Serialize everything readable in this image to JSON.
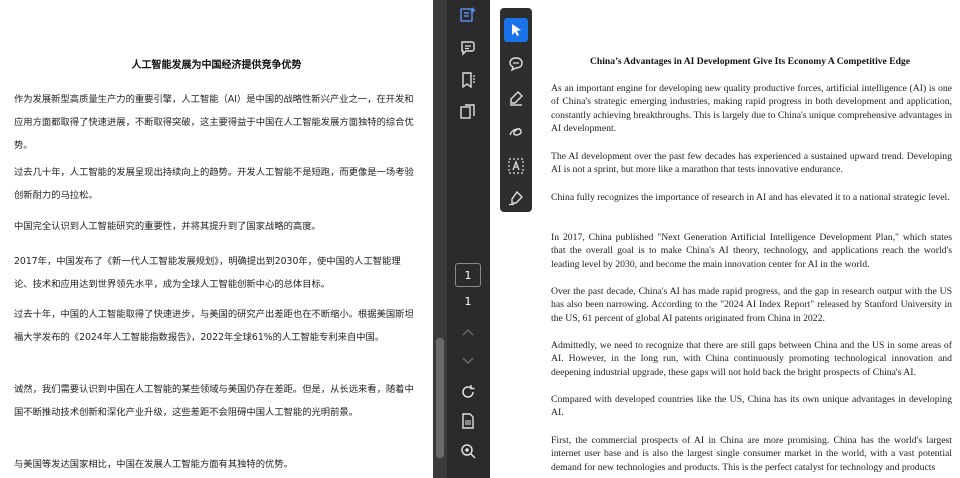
{
  "left_document": {
    "title": "人工智能发展为中国经济提供竞争优势",
    "paragraphs": [
      "作为发展新型高质量生产力的重要引擎，人工智能（AI）是中国的战略性新兴产业之一，在开发和应用方面都取得了快速进展，不断取得突破，这主要得益于中国在人工智能发展方面独特的综合优势。",
      "过去几十年，人工智能的发展呈现出持续向上的趋势。开发人工智能不是短跑，而更像是一场考验创新耐力的马拉松。",
      "中国完全认识到人工智能研究的重要性，并将其提升到了国家战略的高度。",
      "2017年，中国发布了《新一代人工智能发展规划》，明确提出到2030年，使中国的人工智能理论、技术和应用达到世界领先水平，成为全球人工智能创新中心的总体目标。",
      "过去十年，中国的人工智能取得了快速进步，与美国的研究产出差距也在不断缩小。根据美国斯坦福大学发布的《2024年人工智能指数报告》，2022年全球61%的人工智能专利来自中国。",
      "诚然，我们需要认识到中国在人工智能的某些领域与美国仍存在差距。但是，从长远来看，随着中国不断推动技术创新和深化产业升级，这些差距不会阻碍中国人工智能的光明前景。",
      "与美国等发达国家相比，中国在发展人工智能方面有其独特的优势。"
    ]
  },
  "toolbar": {
    "icons": [
      "ai-assistant-icon",
      "comment-list-icon",
      "bookmark-icon",
      "pages-icon"
    ],
    "current_page": "1",
    "total_pages": "1",
    "bottom_icons": [
      "chevron-up-icon",
      "chevron-down-icon",
      "rotate-icon",
      "fit-page-icon",
      "zoom-in-icon"
    ]
  },
  "palette": {
    "tools": [
      "select-pointer-icon",
      "comment-icon",
      "highlight-pen-icon",
      "freehand-draw-icon",
      "text-box-icon",
      "sign-icon"
    ]
  },
  "right_document": {
    "title": "China’s Advantages in AI Development Give Its Economy A Competitive Edge",
    "paragraphs": [
      "As an important engine for developing new quality productive forces, artificial intelligence (AI) is one of China's strategic emerging industries, making rapid progress in both development and application, constantly achieving breakthroughs. This is largely due to China's unique comprehensive advantages in AI development.",
      "The AI development over the past few decades has experienced a sustained upward trend. Developing AI is not a sprint, but more like a marathon that tests innovative endurance.",
      "China fully recognizes the importance of research in AI and has elevated it to a national strategic level.",
      "In 2017, China published \"Next Generation Artificial Intelligence Development Plan,\" which states that the overall goal is to make China's AI theory, technology, and applications reach the world's leading level by 2030, and become the main innovation center for AI in the world.",
      "Over the past decade, China's AI has made rapid progress, and the gap in research output with the US has also been narrowing. According to the \"2024 AI Index Report\" released by Stanford University in the US, 61 percent of global AI patents originated from China in 2022.",
      "Admittedly, we need to recognize that there are still gaps between China and the US in some areas of AI. However, in the long run, with China continuously promoting technological innovation and deepening industrial upgrade, these gaps will not hold back the bright prospects of China's AI.",
      "Compared with developed countries like the US, China has its own unique advantages in developing AI.",
      "First, the commercial prospects of AI in China are more promising. China has the world's largest internet user base and is also the largest single consumer market in the world, with a vast potential demand for new technologies and products. This is the perfect catalyst for technology and products"
    ]
  },
  "colors": {
    "toolbar_bg": "#2b2b2b",
    "active_tool": "#1a73e8",
    "icon_color": "#e0e0e0"
  }
}
